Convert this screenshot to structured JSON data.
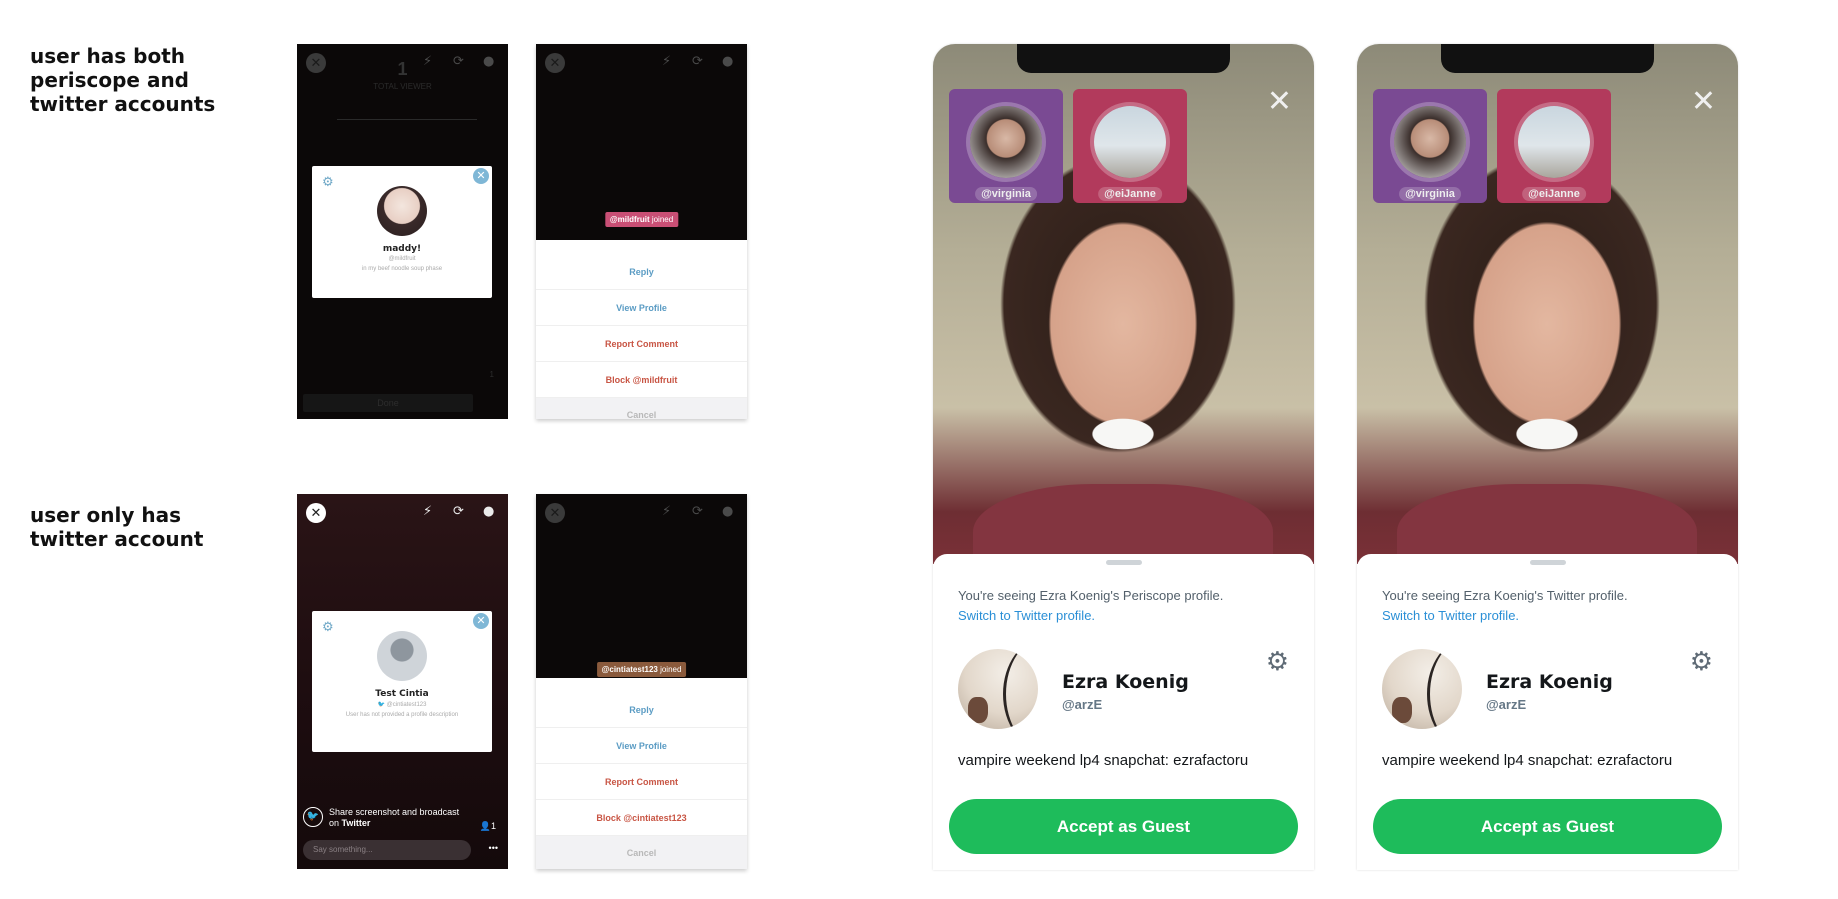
{
  "labels": {
    "both_accounts": "user has both\nperiscope and\ntwitter accounts",
    "twitter_only": "user only has\ntwitter account"
  },
  "phone1": {
    "viewer_count": "1",
    "viewer_label": "TOTAL VIEWER",
    "profile_name": "maddy!",
    "profile_handle": "@mildfruit",
    "profile_bio": "in my beef noodle soup phase",
    "done_label": "Done",
    "viewer_badge": "1"
  },
  "phone2": {
    "joined_handle": "@mildfruit",
    "joined_suffix": " joined",
    "menu": {
      "reply": "Reply",
      "view_profile": "View Profile",
      "report": "Report Comment",
      "block": "Block @mildfruit",
      "cancel": "Cancel"
    },
    "joined_color": "#c94f75"
  },
  "phone3": {
    "profile_name": "Test Cintia",
    "profile_handle": "@cintiatest123",
    "profile_bio": "User has not provided a profile description",
    "share_line1": "Share screenshot and broadcast",
    "share_on": "on ",
    "share_twitter": "Twitter",
    "viewer_badge": "1",
    "say_placeholder": "Say something...",
    "more_glyph": "•••"
  },
  "phone4": {
    "joined_handle": "@cintiatest123",
    "joined_suffix": " joined",
    "menu": {
      "reply": "Reply",
      "view_profile": "View Profile",
      "report": "Report Comment",
      "block": "Block @cintiatest123",
      "cancel": "Cancel"
    },
    "joined_color": "#8a5a3c"
  },
  "big_left": {
    "guest1": "@virginia",
    "guest2": "@eiJanne",
    "seeing_text": "You're seeing Ezra Koenig's Periscope profile.",
    "switch_text": "Switch to Twitter profile.",
    "name": "Ezra Koenig",
    "handle": "@arzE",
    "bio": "vampire weekend lp4 snapchat: ezrafactoru",
    "accept": "Accept as Guest"
  },
  "big_right": {
    "guest1": "@virginia",
    "guest2": "@eiJanne",
    "seeing_text": "You're seeing Ezra Koenig's Twitter profile.",
    "switch_text": "Switch to Twitter profile.",
    "name": "Ezra Koenig",
    "handle": "@arzE",
    "bio": "vampire weekend lp4 snapchat: ezrafactoru",
    "accept": "Accept as Guest"
  },
  "colors": {
    "accept_green": "#1ebc5b",
    "link_blue": "#2a8fd6",
    "tile_purple": "#7a4a93",
    "tile_red": "#b23a5c"
  }
}
